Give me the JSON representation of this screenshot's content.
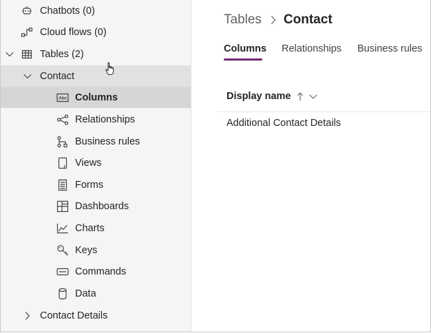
{
  "sidebar": {
    "chatbots": "Chatbots (0)",
    "cloud_flows": "Cloud flows (0)",
    "tables": "Tables (2)",
    "contact": "Contact",
    "columns": "Columns",
    "relationships": "Relationships",
    "business_rules": "Business rules",
    "views": "Views",
    "forms": "Forms",
    "dashboards": "Dashboards",
    "charts": "Charts",
    "keys": "Keys",
    "commands": "Commands",
    "data": "Data",
    "contact_details": "Contact Details"
  },
  "breadcrumb": {
    "parent": "Tables",
    "current": "Contact"
  },
  "tabs": {
    "columns": "Columns",
    "relationships": "Relationships",
    "business_rules": "Business rules"
  },
  "grid": {
    "header": "Display name",
    "rows": [
      "Additional Contact Details"
    ]
  },
  "colors": {
    "accent": "#742774",
    "sidebar_bg": "#f5f5f5",
    "selected_bg": "#d6d6d6"
  }
}
